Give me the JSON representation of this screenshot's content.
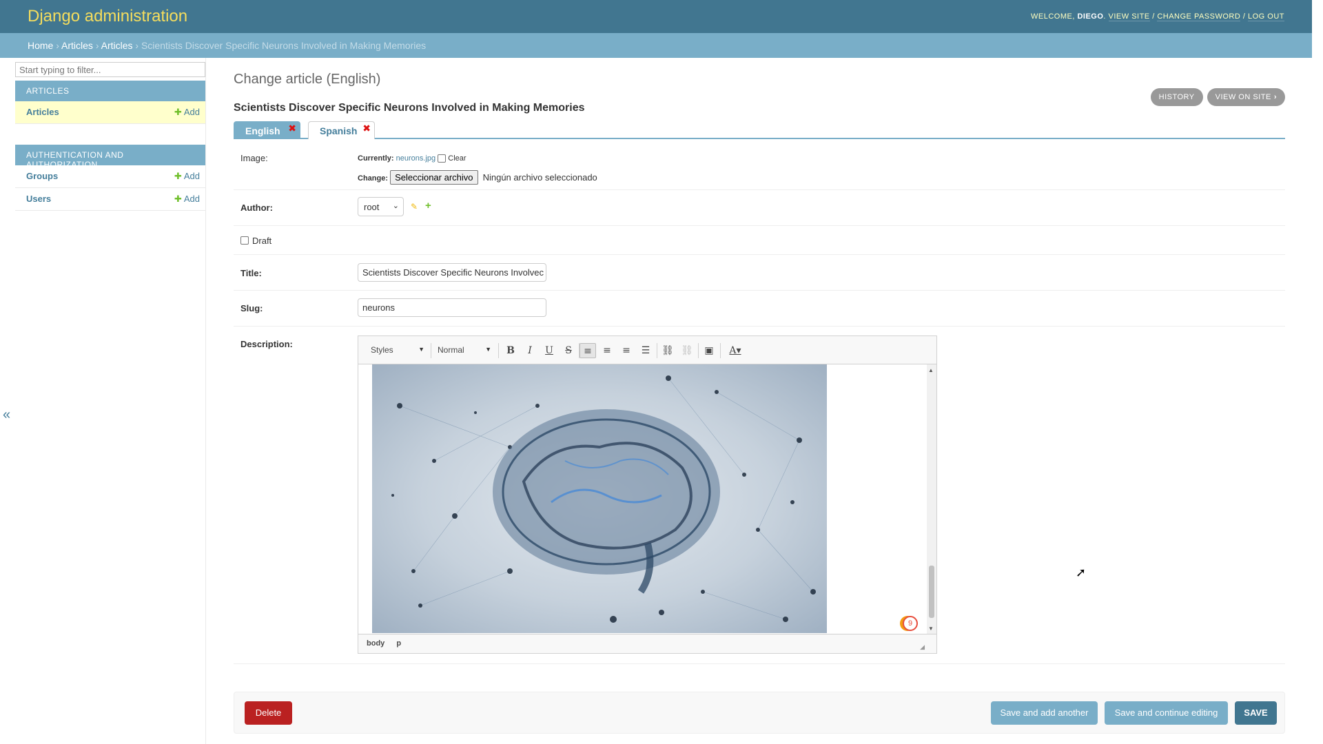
{
  "header": {
    "site_name": "Django administration",
    "welcome": "Welcome,",
    "username": "Diego",
    "view_site": "View site",
    "change_password": "Change password",
    "logout": "Log out"
  },
  "breadcrumbs": {
    "home": "Home",
    "app": "Articles",
    "model": "Articles",
    "current": "Scientists Discover Specific Neurons Involved in Making Memories"
  },
  "sidebar": {
    "filter_placeholder": "Start typing to filter...",
    "add_label": "Add",
    "modules": [
      {
        "caption": "Articles",
        "items": [
          {
            "label": "Articles"
          }
        ]
      },
      {
        "caption": "Authentication and Authorization",
        "items": [
          {
            "label": "Groups"
          },
          {
            "label": "Users"
          }
        ]
      }
    ],
    "collapse_icon": "«"
  },
  "content": {
    "page_title": "Change article (English)",
    "object_title": "Scientists Discover Specific Neurons Involved in Making Memories",
    "object_tools": {
      "history": "History",
      "view_on_site": "View on site"
    },
    "lang_tabs": [
      {
        "label": "English"
      },
      {
        "label": "Spanish"
      }
    ],
    "fields": {
      "image": {
        "label": "Image:",
        "currently_label": "Currently:",
        "current_file": "neurons.jpg",
        "clear_label": "Clear",
        "change_label": "Change:",
        "choose_button": "Seleccionar archivo",
        "no_file": "Ningún archivo seleccionado"
      },
      "author": {
        "label": "Author:",
        "value": "root"
      },
      "draft": {
        "label": "Draft",
        "checked": false
      },
      "title": {
        "label": "Title:",
        "value": "Scientists Discover Specific Neurons Involvec"
      },
      "slug": {
        "label": "Slug:",
        "value": "neurons"
      },
      "description": {
        "label": "Description:",
        "styles_combo": "Styles",
        "format_combo": "Normal",
        "path": [
          "body",
          "p"
        ],
        "badge_count": "9"
      }
    },
    "submit": {
      "delete": "Delete",
      "save_add_another": "Save and add another",
      "save_continue": "Save and continue editing",
      "save": "Save"
    }
  },
  "colors": {
    "header_bg": "#417690",
    "breadcrumbs_bg": "#79aec8",
    "accent_yellow": "#f5dd5d",
    "delete_red": "#ba2121",
    "add_green": "#70bf2b"
  }
}
